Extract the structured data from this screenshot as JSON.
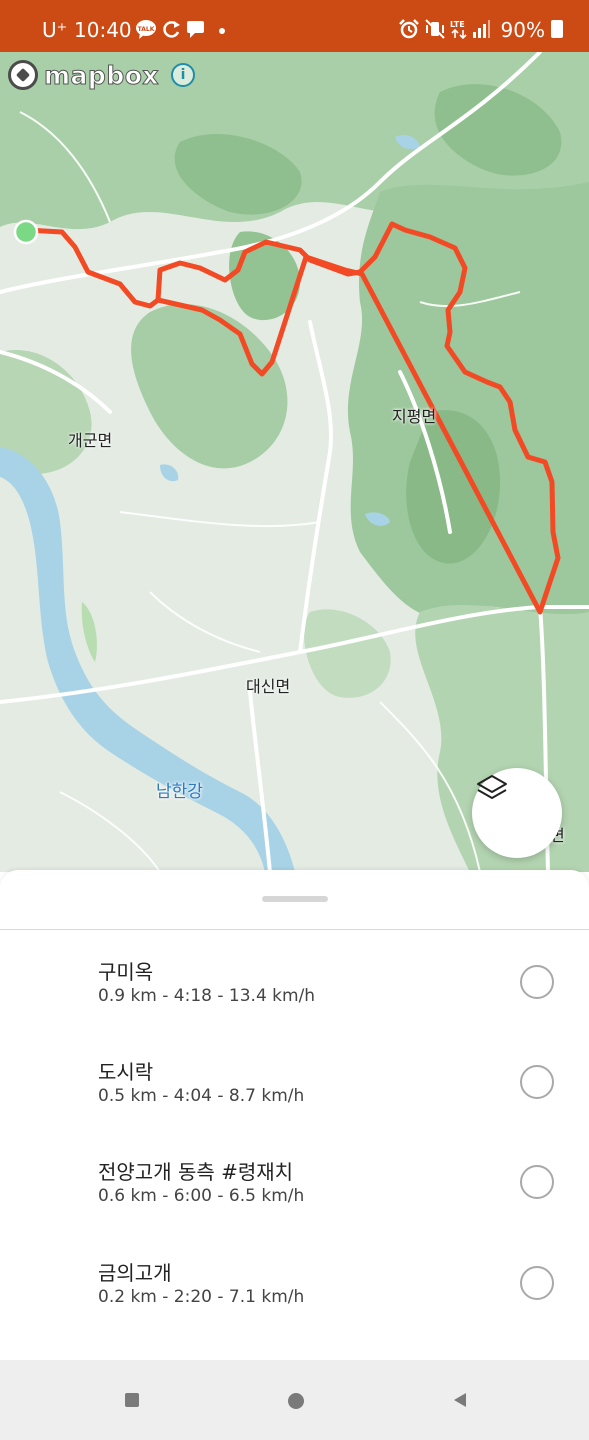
{
  "status_bar": {
    "carrier": "U⁺",
    "time": "10:40",
    "left_icons": [
      "talk-icon",
      "sync-icon",
      "message-icon",
      "dot-icon"
    ],
    "right_icons": [
      "alarm-icon",
      "vibrate-mute-icon",
      "lte-icon",
      "signal-icon"
    ],
    "battery": "90%"
  },
  "map": {
    "attribution_logo": "mapbox",
    "info_label": "i",
    "labels": {
      "gaegun": "개군면",
      "jipyeong": "지평면",
      "daesin": "대신면",
      "namhangang": "남한강",
      "edge_cut": "면"
    },
    "route_color": "#f24a24",
    "start_marker_color": "#7bd884"
  },
  "sheet": {
    "segments": [
      {
        "name": "구미옥",
        "stats": "0.9 km - 4:18 - 13.4 km/h",
        "selected": false
      },
      {
        "name": "도시락",
        "stats": "0.5 km - 4:04 - 8.7 km/h",
        "selected": false
      },
      {
        "name": "전양고개 동측 #령재치",
        "stats": "0.6 km - 6:00 - 6.5 km/h",
        "selected": false
      },
      {
        "name": "금의고개",
        "stats": "0.2 km - 2:20 - 7.1 km/h",
        "selected": false
      }
    ]
  }
}
